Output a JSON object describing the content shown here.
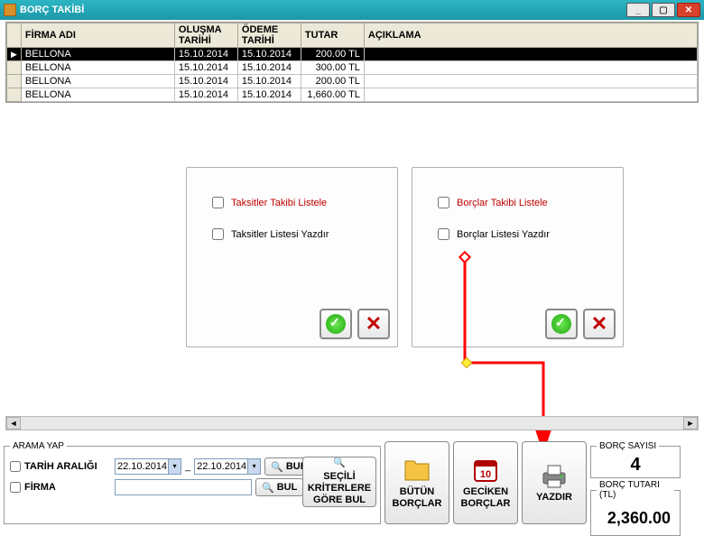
{
  "window": {
    "title": "BORÇ TAKİBİ"
  },
  "grid": {
    "headers": {
      "firma": "FİRMA ADI",
      "olusma": "OLUŞMA TARİHİ",
      "odeme": "ÖDEME TARİHİ",
      "tutar": "TUTAR",
      "aciklama": "AÇIKLAMA"
    },
    "rows": [
      {
        "firma": "BELLONA",
        "olusma": "15.10.2014",
        "odeme": "15.10.2014",
        "tutar": "200.00 TL",
        "aciklama": "",
        "sel": true
      },
      {
        "firma": "BELLONA",
        "olusma": "15.10.2014",
        "odeme": "15.10.2014",
        "tutar": "300.00 TL",
        "aciklama": ""
      },
      {
        "firma": "BELLONA",
        "olusma": "15.10.2014",
        "odeme": "15.10.2014",
        "tutar": "200.00 TL",
        "aciklama": ""
      },
      {
        "firma": "BELLONA",
        "olusma": "15.10.2014",
        "odeme": "15.10.2014",
        "tutar": "1,660.00 TL",
        "aciklama": ""
      }
    ]
  },
  "panels": {
    "left": {
      "opt1": "Taksitler Takibi Listele",
      "opt2": "Taksitler Listesi Yazdır"
    },
    "right": {
      "opt1": "Borçlar Takibi Listele",
      "opt2": "Borçlar Listesi Yazdır"
    }
  },
  "search": {
    "legend": "ARAMA YAP",
    "tarih_label": "TARİH ARALIĞI",
    "firma_label": "FİRMA",
    "date1": "22.10.2014",
    "date2": "22.10.2014",
    "sep": "_",
    "bul": "BUL",
    "secili": "SEÇİLİ KRİTERLERE GÖRE BUL"
  },
  "buttons": {
    "butun": "BÜTÜN BORÇLAR",
    "geciken": "GECİKEN BORÇLAR",
    "yazdir": "YAZDIR"
  },
  "counts": {
    "sayisi_legend": "BORÇ SAYISI",
    "sayisi": "4",
    "tutar_legend": "BORÇ TUTARI (TL)",
    "tutar": "2,360.00"
  }
}
